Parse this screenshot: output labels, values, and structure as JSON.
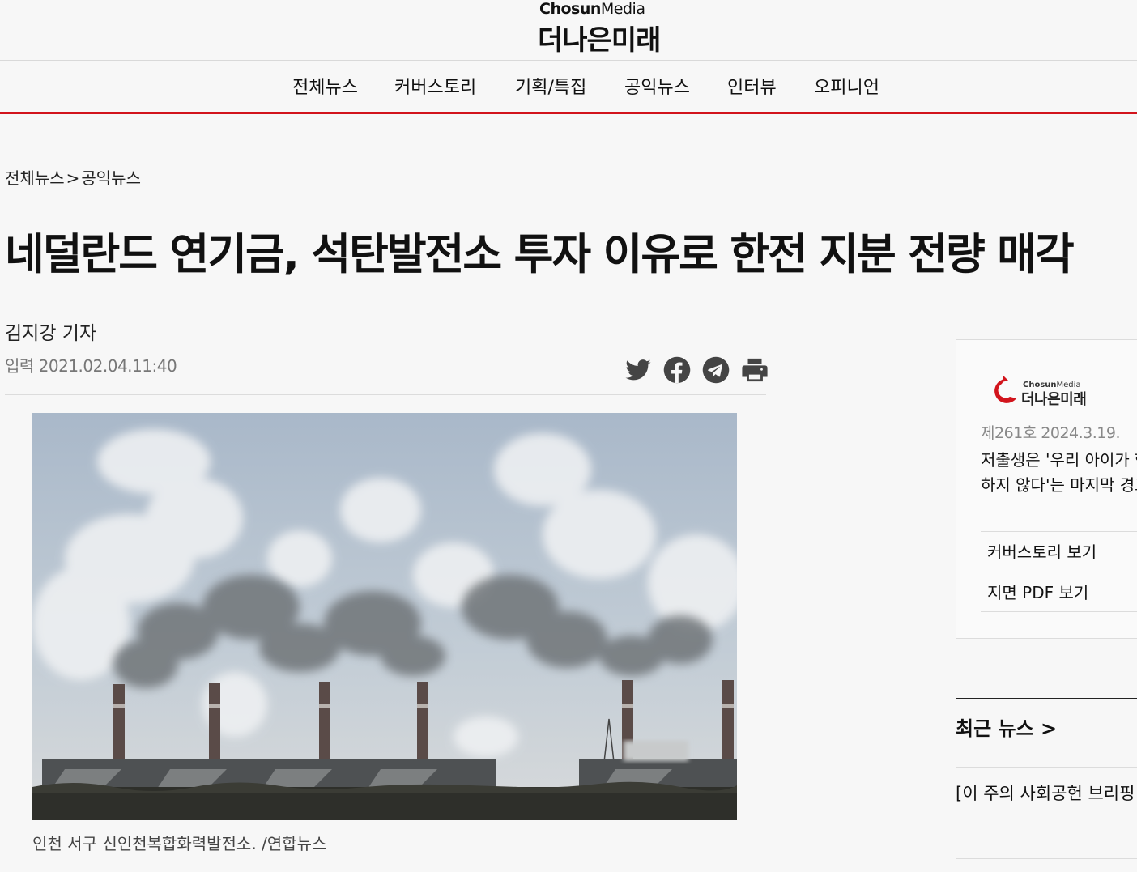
{
  "brand": {
    "small_a": "Chosun",
    "small_b": "Media",
    "main": "더나은미래"
  },
  "nav": {
    "items": [
      "전체뉴스",
      "커버스토리",
      "기획/특집",
      "공익뉴스",
      "인터뷰",
      "오피니언"
    ]
  },
  "article": {
    "breadcrumb": [
      "전체뉴스",
      "공익뉴스"
    ],
    "breadcrumb_sep": ">",
    "title": "네덜란드 연기금, 석탄발전소 투자 이유로 한전 지분 전량 매각",
    "author": "김지강 기자",
    "date": "입력 2021.02.04.11:40",
    "share_icons": [
      "twitter-icon",
      "facebook-icon",
      "telegram-icon",
      "print-icon"
    ],
    "caption": "인천 서구 신인천복합화력발전소. /연합뉴스"
  },
  "sidebar": {
    "issue": {
      "logo_small_a": "Chosun",
      "logo_small_b": "Media",
      "logo_main": "더나은미래",
      "number": "제261호 2024.3.19.",
      "headline": "저출생은 '우리 아이가 행복하지 않다'는 마지막 경고",
      "links": [
        "커버스토리 보기",
        "지면 PDF 보기"
      ]
    },
    "recent": {
      "title": "최근 뉴스 >",
      "items": [
        "[이 주의 사회공헌 브리핑"
      ]
    }
  },
  "colors": {
    "accent": "#d2141c",
    "background": "#f7f7f7"
  }
}
